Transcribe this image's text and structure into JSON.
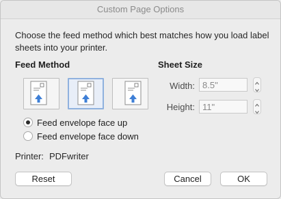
{
  "window": {
    "title": "Custom Page Options"
  },
  "instruction": "Choose the feed method which best matches how you load label sheets into your printer.",
  "feed_method": {
    "heading": "Feed Method",
    "selected_option": "center",
    "options": [
      {
        "position": "left",
        "icon": "envelope-feed-left-icon"
      },
      {
        "position": "center",
        "icon": "envelope-feed-center-icon"
      },
      {
        "position": "right",
        "icon": "envelope-feed-right-icon"
      }
    ],
    "orientation": {
      "selected": "face up",
      "face_up_label": "Feed envelope face up",
      "face_down_label": "Feed envelope face down"
    }
  },
  "sheet_size": {
    "heading": "Sheet Size",
    "width_label": "Width:",
    "width_value": "8.5\"",
    "height_label": "Height:",
    "height_value": "11\""
  },
  "printer": {
    "label": "Printer:",
    "value": "PDFwriter"
  },
  "buttons": {
    "reset": "Reset",
    "cancel": "Cancel",
    "ok": "OK"
  },
  "colors": {
    "selection_border": "#8fb1de",
    "arrow_blue": "#3e7fd6",
    "window_bg": "#ececec"
  }
}
